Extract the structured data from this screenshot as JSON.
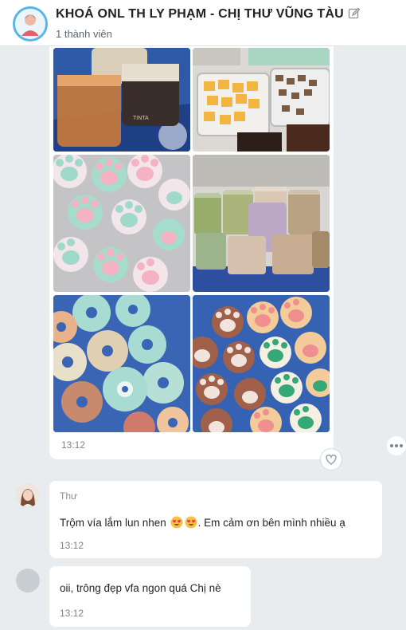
{
  "header": {
    "title": "KHOÁ ONL TH LY PHẠM - CHỊ THƯ VŨNG TÀU",
    "subtitle": "1 thành viên",
    "avatar_icon": "group-avatar-icon",
    "edit_icon": "edit-icon"
  },
  "photo_message": {
    "images": [
      "drinks-cups-photo",
      "jelly-trays-photo",
      "paw-cookies-mint-photo",
      "milk-tea-cups-photo",
      "donut-cookies-photo",
      "paw-cookies-brown-photo"
    ],
    "time": "13:12",
    "reaction_icon": "heart-icon",
    "more_icon": "more-icon"
  },
  "messages": [
    {
      "sender": "Thư",
      "text_before": "Trộm vía lắm lun nhen",
      "emojis": [
        "heart-eyes-emoji",
        "heart-eyes-emoji"
      ],
      "text_after": ". Em cảm ơn bên mình nhiều ạ",
      "time": "13:12"
    },
    {
      "text": "oii, trông đẹp vfa ngon quá Chị nè",
      "time": "13:12"
    }
  ],
  "colors": {
    "background": "#e9ecef",
    "bubble": "#ffffff",
    "accent": "#57b6e6"
  }
}
